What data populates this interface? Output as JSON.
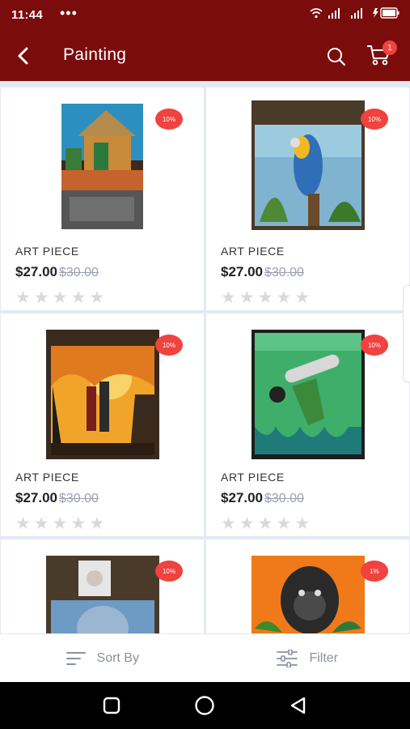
{
  "status_bar": {
    "time": "11:44",
    "dots": "•••"
  },
  "app_bar": {
    "title": "Painting",
    "cart_count": "1"
  },
  "products": [
    {
      "name": "ART PIECE",
      "price": "$27.00",
      "old_price": "$30.00",
      "discount": "10%",
      "rating": 0
    },
    {
      "name": "ART PIECE",
      "price": "$27.00",
      "old_price": "$30.00",
      "discount": "10%",
      "rating": 0
    },
    {
      "name": "ART PIECE",
      "price": "$27.00",
      "old_price": "$30.00",
      "discount": "10%",
      "rating": 0
    },
    {
      "name": "ART PIECE",
      "price": "$27.00",
      "old_price": "$30.00",
      "discount": "10%",
      "rating": 0
    },
    {
      "name": "",
      "price": "",
      "old_price": "",
      "discount": "10%",
      "rating": 0
    },
    {
      "name": "",
      "price": "",
      "old_price": "",
      "discount": "1%",
      "rating": 0
    }
  ],
  "bottom_bar": {
    "sort_label": "Sort By",
    "filter_label": "Filter"
  },
  "colors": {
    "app_bar": "#7a0c0c",
    "badge": "#f0423f",
    "star_empty": "#d7d9de"
  }
}
